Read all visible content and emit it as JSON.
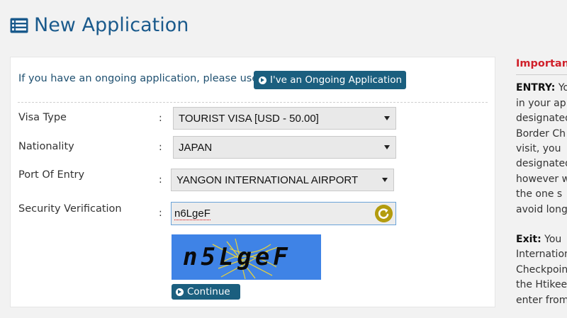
{
  "header": {
    "title": "New Application"
  },
  "form": {
    "ongoing_text": "If you have an ongoing application, please use.",
    "ongoing_button": "I've an Ongoing Application",
    "colon": ":",
    "visa_type": {
      "label": "Visa Type",
      "value": "TOURIST VISA [USD - 50.00]"
    },
    "nationality": {
      "label": "Nationality",
      "value": "JAPAN"
    },
    "port": {
      "label": "Port Of Entry",
      "value": "YANGON INTERNATIONAL AIRPORT"
    },
    "security": {
      "label": "Security Verification",
      "input_value": "n6LgeF",
      "captcha_text": "n5LgeF"
    },
    "continue_button": "Continue"
  },
  "side": {
    "title": "Important",
    "entry_label": "ENTRY:",
    "entry_lines": [
      " Yo",
      "in your ap",
      "designated",
      "Border Ch",
      "visit, you",
      "designated",
      "however w",
      "the one s",
      "avoid longe"
    ],
    "exit_label": "Exit:",
    "exit_lines": [
      " You",
      "Internation",
      "Checkpoin",
      "the Htikee",
      "enter from"
    ]
  },
  "colors": {
    "title_blue": "#1a5a8c",
    "button_teal": "#1b5f7f",
    "important_red": "#d0202a",
    "captcha_bg": "#3f83e6",
    "refresh_gold": "#b39c0f"
  },
  "icons": {
    "title": "list-icon",
    "button": "circle-arrow-right-icon",
    "refresh": "refresh-icon",
    "dropdown": "caret-down-icon"
  }
}
